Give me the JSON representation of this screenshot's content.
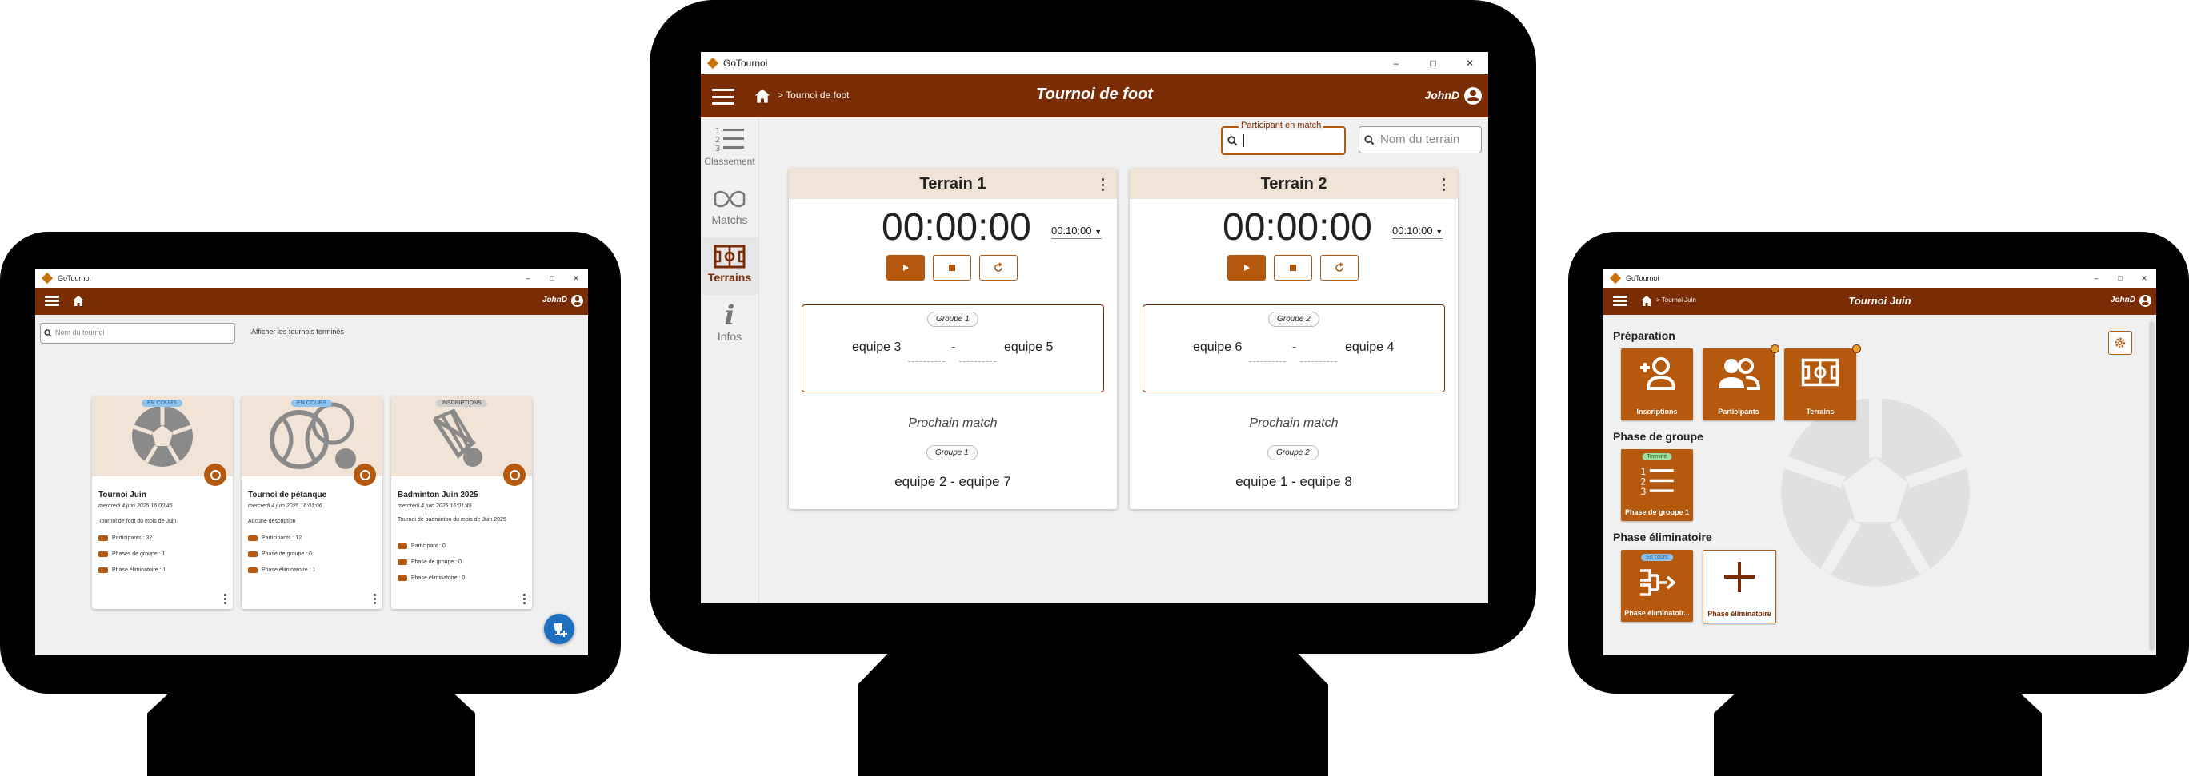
{
  "left": {
    "window_title": "GoTournoi",
    "search_placeholder": "Nom du tournoi",
    "show_finished": "Afficher les tournois terminés",
    "user": "JohnD",
    "tournaments": [
      {
        "status": "EN COURS",
        "name": "Tournoi Juin",
        "date": "mercredi 4 juin 2025 16:00:46",
        "desc": "Tournoi de foot du mois de Juin.",
        "participants": "Participants : 32",
        "groups": "Phases de groupe : 1",
        "elim": "Phase éliminatoire : 1",
        "sport_icon": "soccer-ball-icon"
      },
      {
        "status": "EN COURS",
        "name": "Tournoi de pétanque",
        "date": "mercredi 4 juin 2025 16:01:06",
        "desc": "Aucune description",
        "participants": "Participants : 12",
        "groups": "Phase de groupe : 0",
        "elim": "Phase éliminatoire : 1",
        "sport_icon": "petanque-icon"
      },
      {
        "status": "INSCRIPTIONS",
        "name": "Badminton Juin 2025",
        "date": "mercredi 4 juin 2025 16:01:45",
        "desc": "Tournoi de badminton du mois de Juin 2025",
        "participants": "Participant : 0",
        "groups": "Phase de groupe : 0",
        "elim": "Phase éliminatoire : 0",
        "sport_icon": "shuttlecock-icon"
      }
    ]
  },
  "center": {
    "window_title": "GoTournoi",
    "breadcrumb": "> Tournoi de foot",
    "title": "Tournoi de foot",
    "user": "JohnD",
    "nav": [
      {
        "label": "Classement",
        "icon": "ranking-icon"
      },
      {
        "label": "Matchs",
        "icon": "versus-icon"
      },
      {
        "label": "Terrains",
        "icon": "field-icon"
      },
      {
        "label": "Infos",
        "icon": "info-icon"
      }
    ],
    "participant_label": "Participant en match",
    "participant_value": "",
    "terrain_placeholder": "Nom du terrain",
    "fields": [
      {
        "name": "Terrain 1",
        "timer": "00:00:00",
        "duration": "00:10:00",
        "group": "Groupe 1",
        "team_a": "equipe 3",
        "sep": "-",
        "team_b": "equipe 5",
        "next_label": "Prochain match",
        "next_group": "Groupe 1",
        "next_match": "equipe 2 - equipe 7"
      },
      {
        "name": "Terrain 2",
        "timer": "00:00:00",
        "duration": "00:10:00",
        "group": "Groupe 2",
        "team_a": "equipe 6",
        "sep": "-",
        "team_b": "equipe 4",
        "next_label": "Prochain match",
        "next_group": "Groupe 2",
        "next_match": "equipe 1 - equipe 8"
      }
    ]
  },
  "right": {
    "window_title": "GoTournoi",
    "breadcrumb": "> Tournoi Juin",
    "title": "Tournoi Juin",
    "user": "JohnD",
    "sections": {
      "prep": "Préparation",
      "group": "Phase de groupe",
      "elim": "Phase éliminatoire"
    },
    "tiles": {
      "inscriptions": "Inscriptions",
      "participants": "Participants",
      "terrains": "Terrains",
      "group1": "Phase de groupe 1",
      "group1_badge": "Terminé",
      "elim1": "Phase éliminatoir...",
      "elim1_badge": "En cours",
      "elim_add": "Phase éliminatoire"
    }
  },
  "colors": {
    "brand": "#7a2d05",
    "accent": "#b5590f",
    "card_bg": "#f1e3d5"
  }
}
